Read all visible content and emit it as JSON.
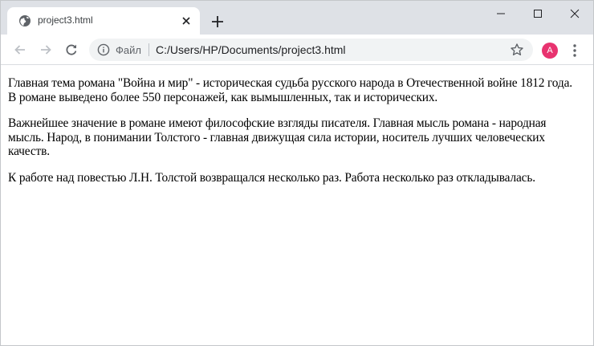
{
  "browser": {
    "tab": {
      "title": "project3.html",
      "favicon": "globe-icon",
      "close_icon": "close-icon"
    },
    "new_tab_icon": "plus-icon",
    "window_controls": {
      "minimize_icon": "minimize-icon",
      "maximize_icon": "maximize-icon",
      "close_icon": "close-icon"
    },
    "toolbar": {
      "back_icon": "back-arrow-icon",
      "forward_icon": "forward-arrow-icon",
      "reload_icon": "reload-icon",
      "info_icon": "info-icon",
      "scheme_label": "Файл",
      "url": "C:/Users/HP/Documents/project3.html",
      "bookmark_icon": "star-icon",
      "profile_initial": "A",
      "profile_color": "#e8336f",
      "menu_icon": "kebab-menu-icon"
    },
    "colors": {
      "tab_strip": "#dee1e6",
      "omnibox_bg": "#f1f3f4"
    }
  },
  "page": {
    "paragraphs": [
      "Главная тема романа \"Война и мир\" - историческая судьба русского народа в Отечественной войне 1812 года. В романе выведено более 550 персонажей, как вымышленных, так и исторических.",
      "Важнейшее значение в романе имеют философские взгляды писателя. Главная мысль романа - народная мысль. Народ, в понимании Толстого - главная движущая сила истории, носитель лучших человеческих качеств.",
      "К работе над повестью Л.Н. Толстой возвращался несколько раз. Работа несколько раз откладывалась."
    ]
  }
}
